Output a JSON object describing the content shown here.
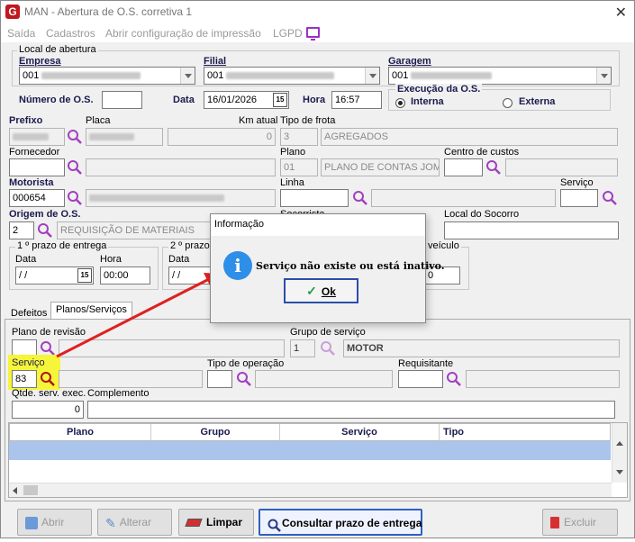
{
  "window": {
    "title": "MAN - Abertura de O.S. corretiva 1",
    "close_glyph": "✕",
    "logo_letter": "G"
  },
  "menu": [
    "Saída",
    "Cadastros",
    "Abrir configuração de impressão",
    "LGPD"
  ],
  "local_abertura": {
    "group_title": "Local de abertura",
    "empresa_label": "Empresa",
    "empresa_value": "001",
    "filial_label": "Filial",
    "filial_value": "001",
    "garagem_label": "Garagem",
    "garagem_value": "001"
  },
  "os": {
    "numero_label": "Número de O.S.",
    "numero_value": "",
    "data_label": "Data",
    "data_value": "16/01/2026",
    "hora_label": "Hora",
    "hora_value": "16:57",
    "execucao_title": "Execução da O.S.",
    "interna_label": "Interna",
    "externa_label": "Externa",
    "execucao_selected": "Interna"
  },
  "veiculo": {
    "prefixo_label": "Prefixo",
    "placa_label": "Placa",
    "km_label": "Km atual",
    "km_value": "0",
    "tipo_frota_label": "Tipo de frota",
    "tipo_frota_code": "3",
    "tipo_frota_name": "AGREGADOS",
    "fornecedor_label": "Fornecedor",
    "plano_label": "Plano",
    "plano_code": "01",
    "plano_name": "PLANO DE CONTAS JOM",
    "centro_custos_label": "Centro de custos",
    "motorista_label": "Motorista",
    "motorista_value": "000654",
    "linha_label": "Linha",
    "servico_label": "Serviço",
    "origem_label": "Origem de O.S.",
    "origem_code": "2",
    "origem_name": "REQUISIÇÃO DE MATERIAIS",
    "socorrista_label": "Socorrista",
    "local_socorro_label": "Local do Socorro"
  },
  "prazos": {
    "prazo1_title": "1 º prazo de entrega",
    "prazo2_title": "2 º prazo",
    "data_label": "Data",
    "hora_label": "Hora",
    "data1_value": " / /",
    "hora1_value": "00:00",
    "data2_value": " / /",
    "veiculo_title": "veículo",
    "veiculo_value": "0"
  },
  "tabs": [
    "Defeitos",
    "Planos/Serviços"
  ],
  "planos_tab": {
    "plano_revisao_label": "Plano de revisão",
    "grupo_servico_label": "Grupo de serviço",
    "grupo_code": "1",
    "grupo_name": "MOTOR",
    "servico_label": "Serviço",
    "servico_value": "83",
    "tipo_operacao_label": "Tipo de operação",
    "requisitante_label": "Requisitante",
    "qtde_label": "Qtde. serv. exec.",
    "qtde_value": "0",
    "complemento_label": "Complemento"
  },
  "grid": {
    "columns": [
      "Plano",
      "Grupo",
      "Serviço",
      "Tipo"
    ]
  },
  "buttons": {
    "abrir": "Abrir",
    "alterar": "Alterar",
    "limpar": "Limpar",
    "consultar": "Consultar prazo de entrega",
    "excluir": "Excluir"
  },
  "dialog": {
    "title": "Informação",
    "icon_glyph": "i",
    "message": "Serviço não existe ou está inativo.",
    "ok_label": "Ok"
  },
  "colors": {
    "accent": "#2e8fe8",
    "highlight": "#f5f53a",
    "arrow": "#e02020",
    "brand": "#c0181f",
    "search": "#a040c0"
  }
}
